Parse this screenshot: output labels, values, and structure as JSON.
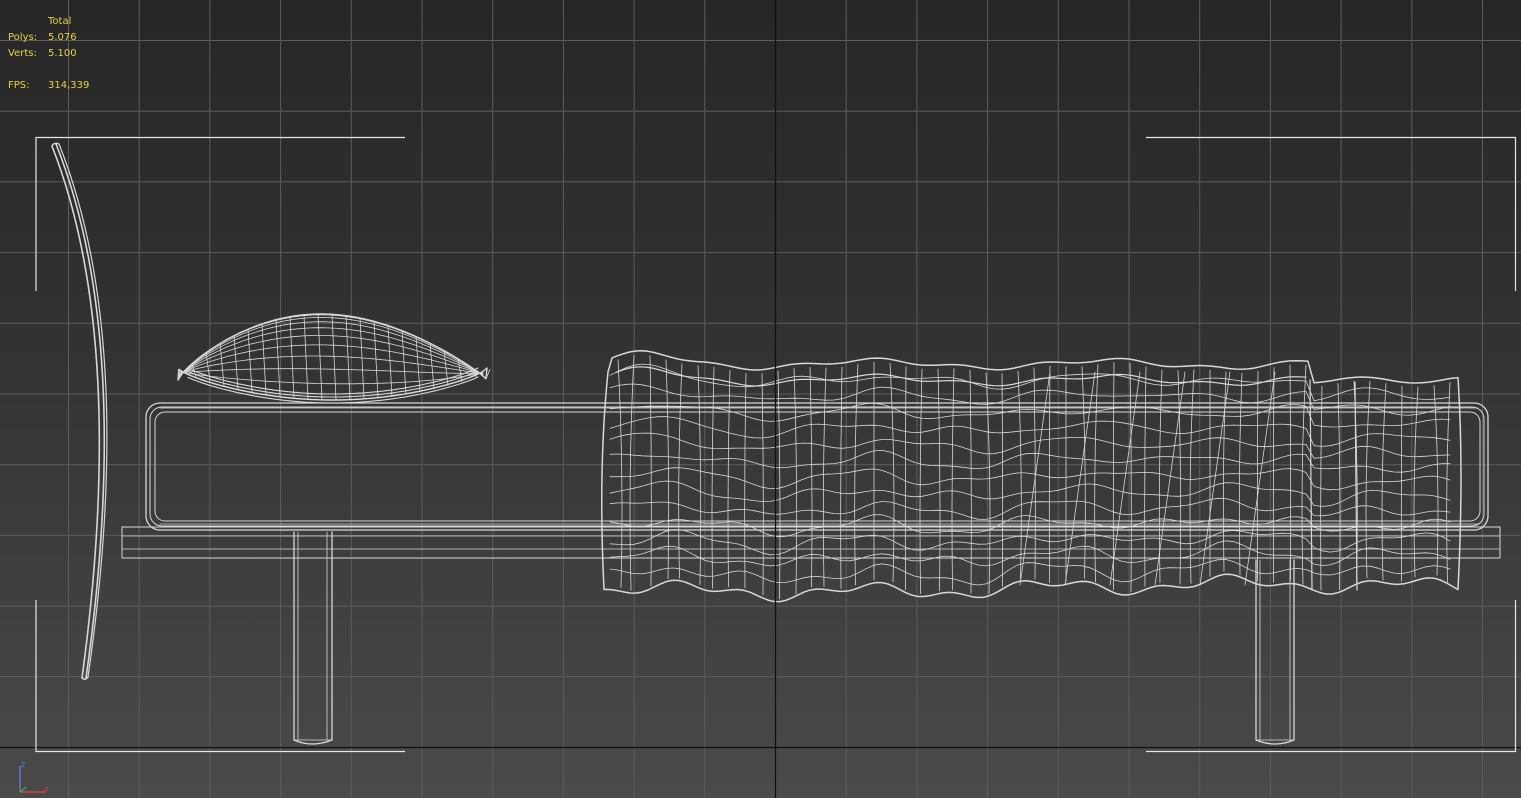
{
  "viewport": {
    "stats": {
      "header": "Total",
      "polys_label": "Polys:",
      "polys_value": "5.076",
      "verts_label": "Verts:",
      "verts_value": "5.100",
      "fps_label": "FPS:",
      "fps_value": "314,339"
    },
    "gizmo": {
      "z_label": "z",
      "x_label": "x"
    },
    "colors": {
      "stats_text": "#e8d24a",
      "grid_line": "#5c5c5c",
      "axis_line": "#111111",
      "wire": "#d8d8d8",
      "frame": "#e6e6e6",
      "gizmo_x": "#d44040",
      "gizmo_z": "#5a7fd8",
      "gizmo_y": "#3fae3f"
    },
    "icons": {
      "axis": "axis-gizmo-icon",
      "frame": "safe-frame-brackets"
    }
  }
}
